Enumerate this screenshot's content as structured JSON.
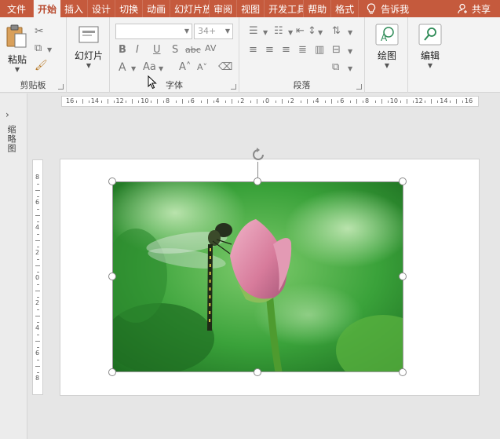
{
  "tabs": [
    {
      "label": "文件"
    },
    {
      "label": "开始",
      "active": true
    },
    {
      "label": "插入"
    },
    {
      "label": "设计"
    },
    {
      "label": "切换"
    },
    {
      "label": "动画"
    },
    {
      "label": "幻灯片放映"
    },
    {
      "label": "审阅"
    },
    {
      "label": "视图"
    },
    {
      "label": "开发工具"
    },
    {
      "label": "帮助"
    },
    {
      "label": "格式"
    }
  ],
  "tell_me": "告诉我",
  "share": "共享",
  "ribbon": {
    "clipboard": {
      "paste": "粘贴",
      "group_label": "剪贴板"
    },
    "slides": {
      "new_slide": "幻灯片",
      "group_label": ""
    },
    "font": {
      "font_name": "",
      "font_size": "34+",
      "group_label": "字体"
    },
    "paragraph": {
      "group_label": "段落"
    },
    "drawing": {
      "label": "绘图"
    },
    "editing": {
      "label": "编辑"
    }
  },
  "left_pane": {
    "label": "缩略图"
  },
  "ruler": {
    "horizontal": [
      "16",
      "14",
      "12",
      "10",
      "8",
      "6",
      "4",
      "2",
      "0",
      "2",
      "4",
      "6",
      "8",
      "10",
      "12",
      "14",
      "16"
    ],
    "vertical": [
      "8",
      "6",
      "4",
      "2",
      "0",
      "2",
      "4",
      "6",
      "8"
    ]
  },
  "colors": {
    "accent": "#c55a3d",
    "ribbon_bg": "#f3f3f3",
    "workspace": "#e6e6e6"
  }
}
